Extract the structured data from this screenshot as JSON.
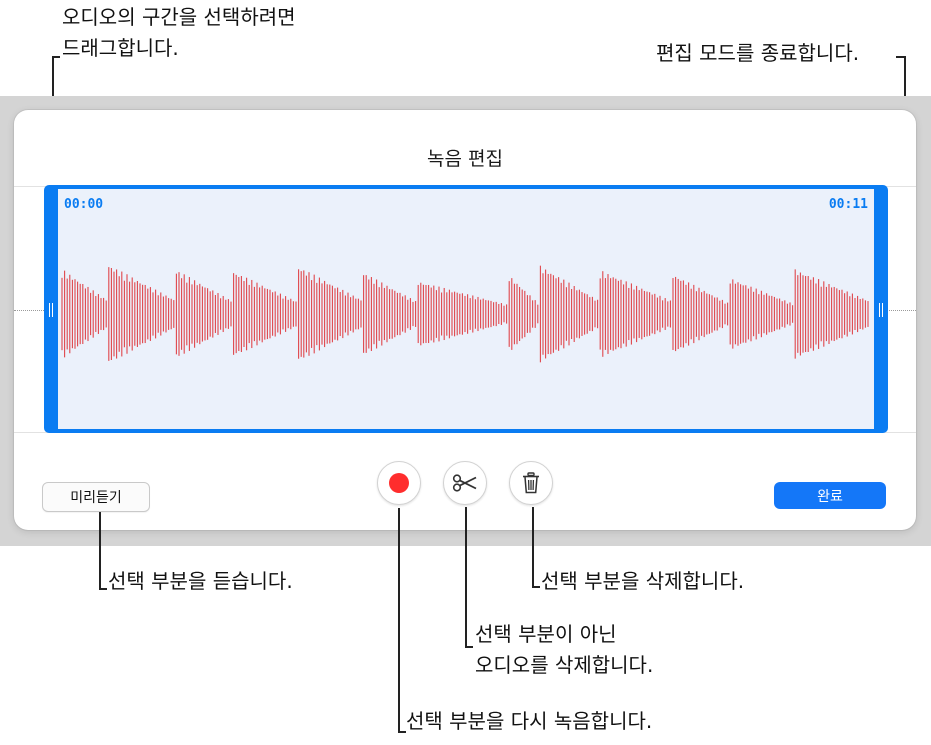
{
  "callouts": {
    "select_drag_line1": "오디오의 구간을 선택하려면",
    "select_drag_line2": "드래그합니다.",
    "exit_edit": "편집 모드를 종료합니다.",
    "preview_selection": "선택 부분을 듣습니다.",
    "delete_selection": "선택 부분을 삭제합니다.",
    "trim_line1": "선택 부분이 아닌",
    "trim_line2": "오디오를 삭제합니다.",
    "rerecord": "선택 부분을 다시 녹음합니다."
  },
  "panel": {
    "title": "녹음 편집",
    "time_start": "00:00",
    "time_end": "00:11",
    "preview_label": "미리듣기",
    "done_label": "완료"
  },
  "icons": {
    "record": "record-icon",
    "trim": "scissors-icon",
    "delete": "trash-icon"
  },
  "colors": {
    "accent": "#0a7cf2",
    "selection_fill": "#ebf1fb",
    "waveform": "#e0464b",
    "record": "#ff2d2d",
    "backdrop": "#d4d4d4"
  }
}
